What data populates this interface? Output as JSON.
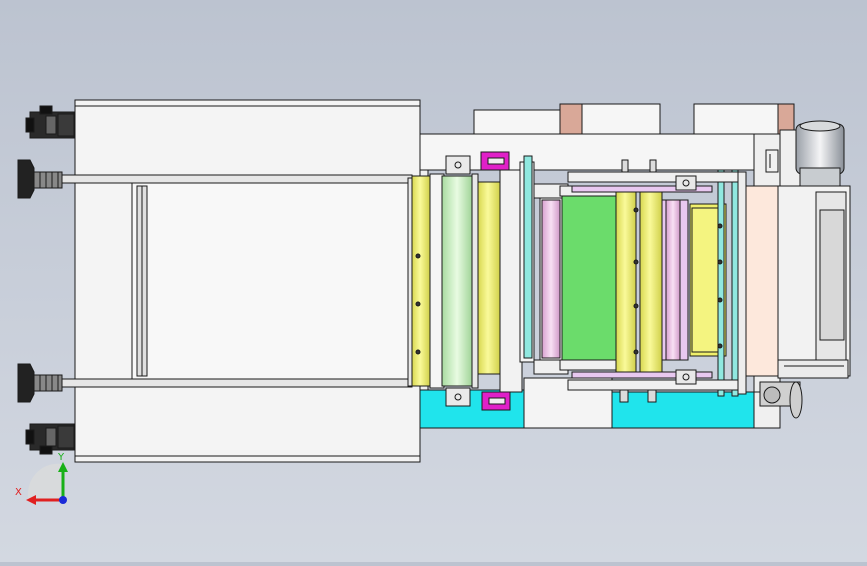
{
  "viewport": {
    "background_top": "#bcc3d0",
    "background_bottom": "#d3d8e1"
  },
  "triad": {
    "x_label": "X",
    "y_label": "Y",
    "x_color": "#e02020",
    "y_color": "#18b018",
    "z_color": "#1a2ad8"
  },
  "part_colors": {
    "panel": "#f2f2f2",
    "yellow": "#f0f06a",
    "light_green": "#c8f0c0",
    "green": "#6bdc6b",
    "pink": "#f0b8e8",
    "lavender": "#e8c8f0",
    "cyan": "#20e4ec",
    "magenta": "#e020c8",
    "salmon": "#d9a898",
    "peach": "#fde8dc",
    "teal": "#90e8e0"
  }
}
